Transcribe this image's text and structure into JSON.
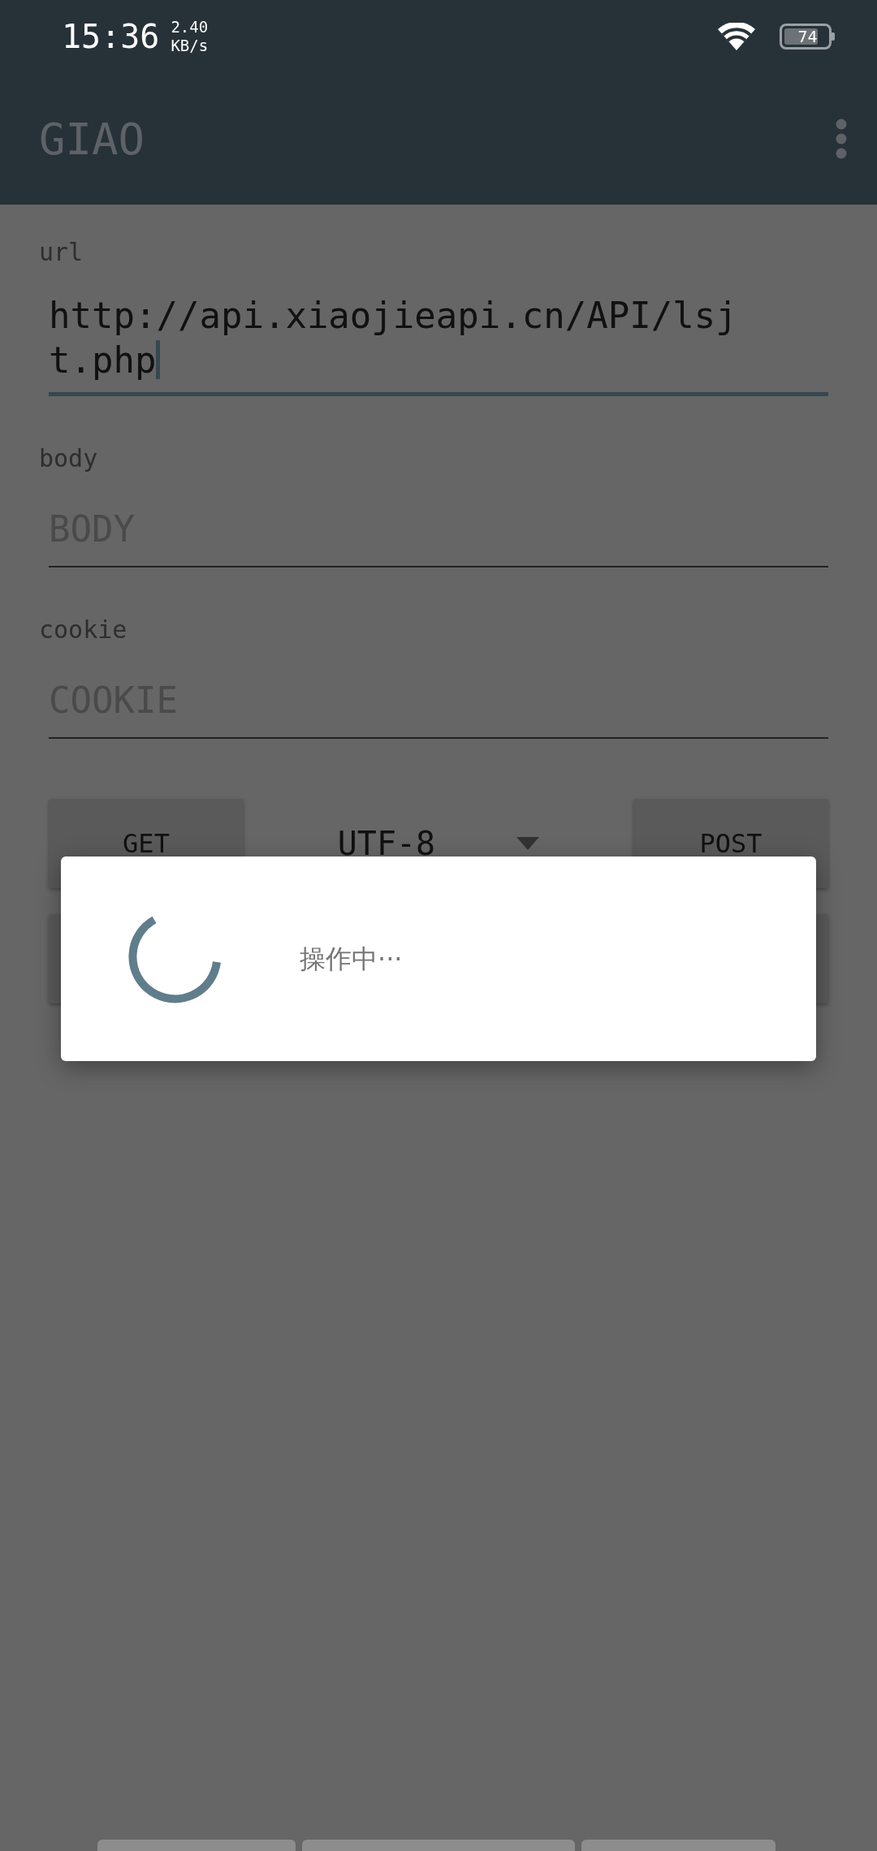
{
  "status_bar": {
    "time": "15:36",
    "speed_value": "2.40",
    "speed_unit": "KB/s",
    "battery": "74"
  },
  "app_bar": {
    "title": "GIAO"
  },
  "fields": [
    {
      "label": "url",
      "value": "http://api.xiaojieapi.cn/API/lsjt.php",
      "focused": true
    },
    {
      "label": "body",
      "placeholder": "BODY",
      "focused": false
    },
    {
      "label": "cookie",
      "placeholder": "COOKIE",
      "focused": false
    }
  ],
  "actions": {
    "get": "GET",
    "encoding": "UTF-8",
    "post": "POST"
  },
  "dialog": {
    "message": "操作中···"
  }
}
